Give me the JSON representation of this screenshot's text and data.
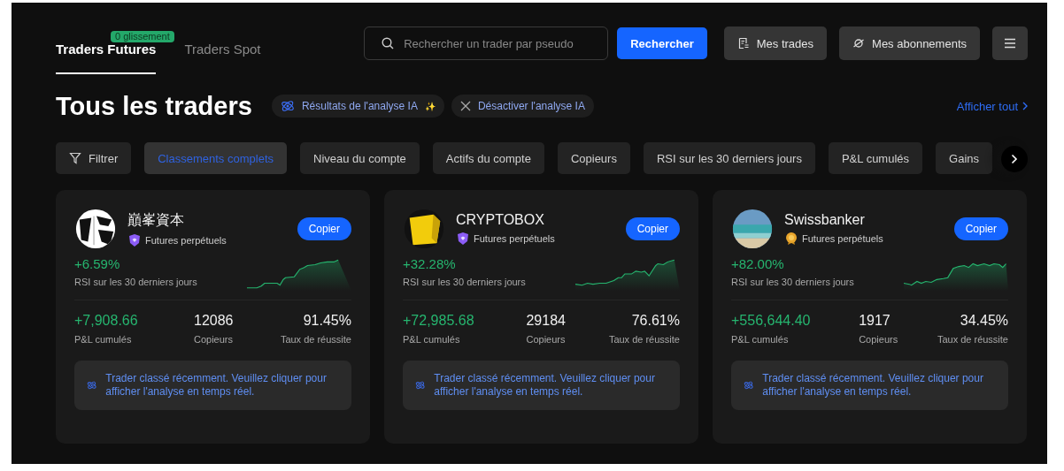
{
  "tabs": [
    {
      "label": "Traders Futures",
      "selected": true,
      "badge": "0 glissement"
    },
    {
      "label": "Traders Spot",
      "selected": false
    }
  ],
  "search": {
    "placeholder": "Rechercher un trader par pseudo",
    "button": "Rechercher"
  },
  "actions": [
    {
      "label": "Mes trades",
      "kind": "trades"
    },
    {
      "label": "Mes abonnements",
      "kind": "subscriptions"
    }
  ],
  "heading": "Tous les traders",
  "ai_chips": [
    {
      "label": "Résultats de l'analyse IA",
      "kind": "results",
      "sparkle": "✨"
    },
    {
      "label": "Désactiver l'analyse IA",
      "kind": "disable"
    }
  ],
  "view_all": "Afficher tout",
  "filter": "Filtrer",
  "chips": [
    {
      "label": "Classements complets",
      "selected": true
    },
    {
      "label": "Niveau du compte",
      "selected": false
    },
    {
      "label": "Actifs du compte",
      "selected": false
    },
    {
      "label": "Copieurs",
      "selected": false
    },
    {
      "label": "RSI sur les 30 derniers jours",
      "selected": false
    },
    {
      "label": "P&L cumulés",
      "selected": false
    },
    {
      "label": "Gains",
      "selected": false
    }
  ],
  "traders": [
    {
      "name": "巔峯資本",
      "avatar": {
        "kind": "calligraphy"
      },
      "badge": {
        "kind": "shield"
      },
      "category": "Futures perpétuels",
      "copy": "Copier",
      "roi": "+6.59%",
      "roi_label": "RSI sur les 30 derniers jours",
      "pnl": "+7,908.66",
      "pnl_label": "P&L cumulés",
      "copiers": "12086",
      "copiers_label": "Copieurs",
      "win_rate": "91.45%",
      "win_label": "Taux de réussite",
      "notice": "Trader classé récemment. Veuillez cliquer pour afficher l'analyse en temps réel."
    },
    {
      "name": "CRYPTOBOX",
      "avatar": {
        "kind": "cube"
      },
      "badge": {
        "kind": "shield"
      },
      "category": "Futures perpétuels",
      "copy": "Copier",
      "roi": "+32.28%",
      "roi_label": "RSI sur les 30 derniers jours",
      "pnl": "+72,985.68",
      "pnl_label": "P&L cumulés",
      "copiers": "29184",
      "copiers_label": "Copieurs",
      "win_rate": "76.61%",
      "win_label": "Taux de réussite",
      "notice": "Trader classé récemment. Veuillez cliquer pour afficher l'analyse en temps réel."
    },
    {
      "name": "Swissbanker",
      "avatar": {
        "kind": "beach"
      },
      "badge": {
        "kind": "medal"
      },
      "category": "Futures perpétuels",
      "copy": "Copier",
      "roi": "+82.00%",
      "roi_label": "RSI sur les 30 derniers jours",
      "pnl": "+556,644.40",
      "pnl_label": "P&L cumulés",
      "copiers": "1917",
      "copiers_label": "Copieurs",
      "win_rate": "34.45%",
      "win_label": "Taux de réussite",
      "notice": "Trader classé récemment. Veuillez cliquer pour afficher l'analyse en temps réel."
    }
  ]
}
